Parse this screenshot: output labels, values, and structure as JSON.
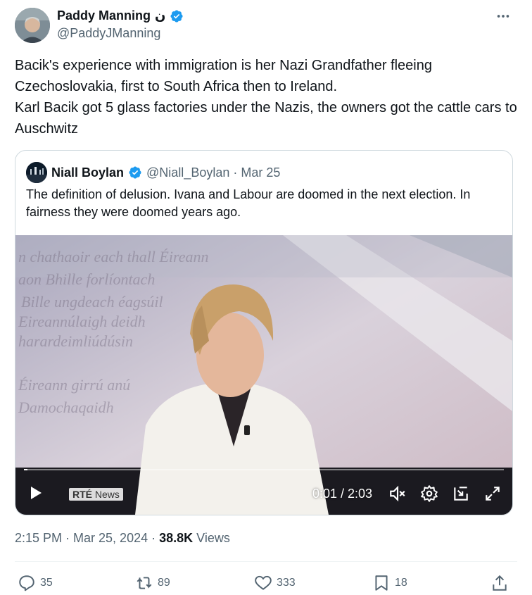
{
  "author": {
    "name": "Paddy Manning",
    "name_suffix": "ن",
    "handle": "@PaddyJManning",
    "verified": true
  },
  "more_icon": "more-horizontal-icon",
  "tweet": {
    "line1": "Bacik's experience with immigration is her Nazi Grandfather fleeing Czechoslovakia, first to South Africa then to Ireland.",
    "line2": "Karl Bacik got 5 glass factories under the Nazis, the owners got the cattle cars to Auschwitz"
  },
  "quote": {
    "name": "Niall Boylan",
    "handle_date": "@Niall_Boylan · Mar 25",
    "text": "The definition of delusion. Ivana and Labour are doomed in the next election. In fairness they were doomed years ago.",
    "video": {
      "logo_brand": "RTÉ",
      "logo_word": "News",
      "time": "0:01 / 2:03",
      "progress": 0.008,
      "background_text": [
        "n chathaoir each thall Éireann",
        "aon Bhille forlíontach",
        "Bille ungdeach éagsúil",
        "Eireannúlaigh deidh",
        "harardeimliúdúsin",
        "Éireann girrú anú",
        "Damochaqaidh"
      ]
    }
  },
  "meta": {
    "time_date": "2:15 PM · Mar 25, 2024 · ",
    "views_count": "38.8K",
    "views_label": " Views"
  },
  "actions": {
    "replies": "35",
    "reposts": "89",
    "likes": "333",
    "bookmarks": "18"
  },
  "colors": {
    "verified": "#1d9bf0",
    "secondary_text": "#536471",
    "border": "#cfd9de"
  }
}
